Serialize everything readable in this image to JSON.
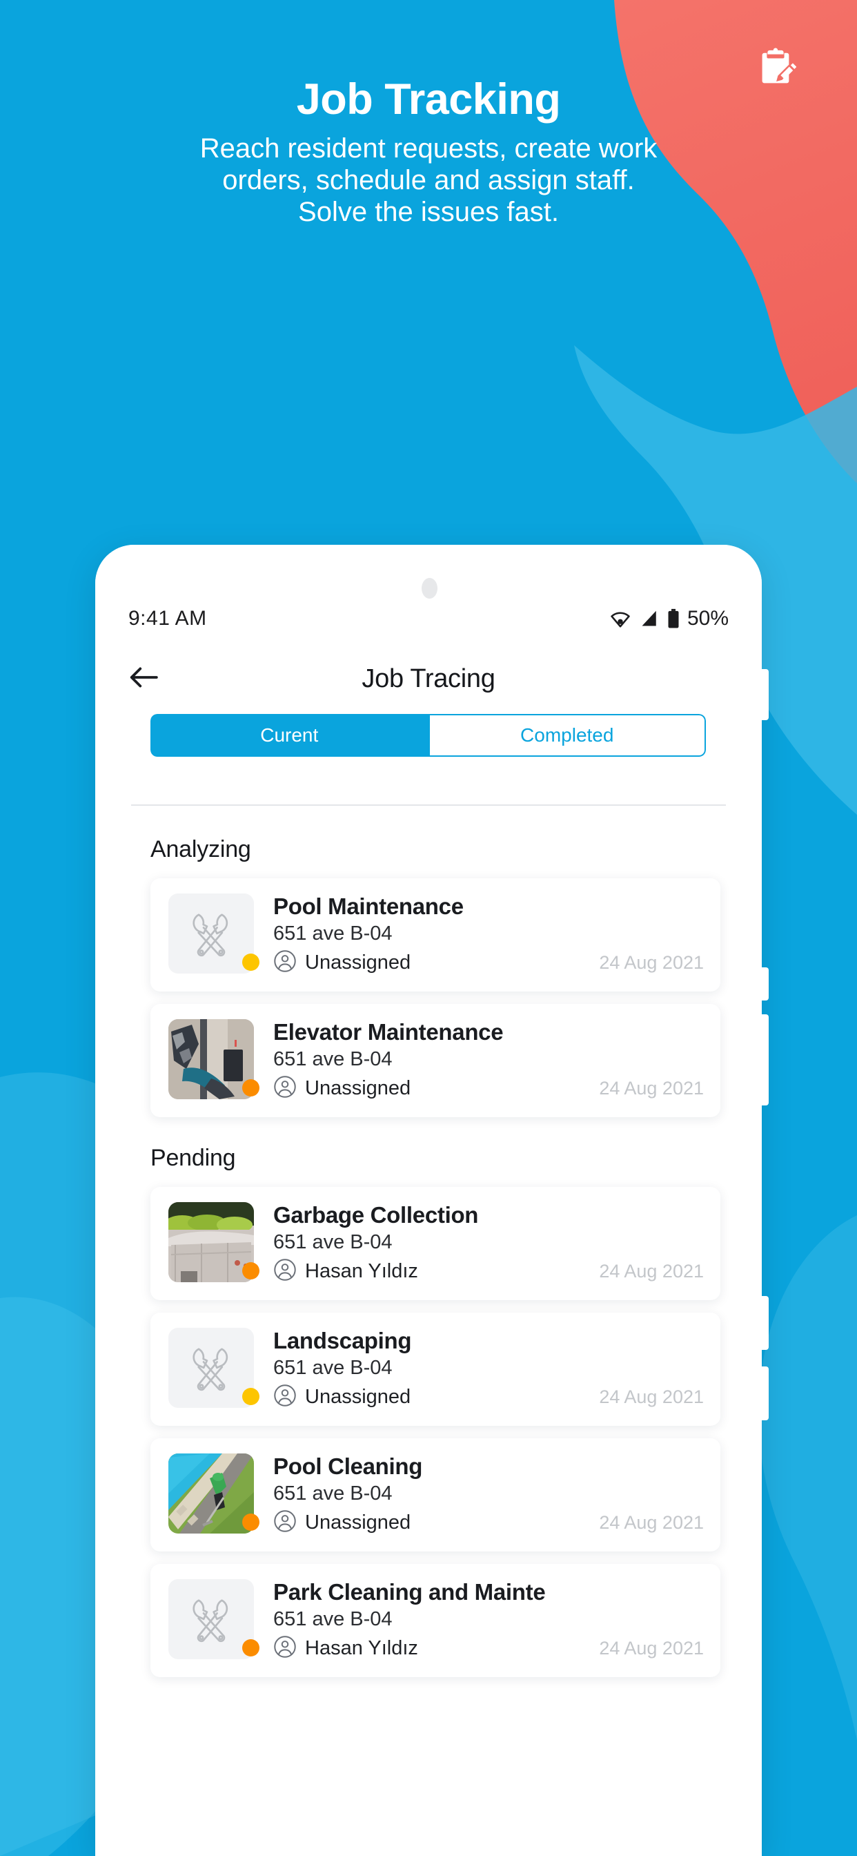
{
  "promo": {
    "title": "Job Tracking",
    "subtitle_lines": [
      "Reach resident requests, create work",
      "orders, schedule and assign staff.",
      "Solve the issues fast."
    ],
    "icon": "clipboard-pencil-icon"
  },
  "colors": {
    "brand_blue": "#0aa4dd",
    "brand_blue_light": "#35b8e6",
    "coral": "#f4695f",
    "status_yellow": "#fdc500",
    "status_orange": "#fb8c00",
    "text_dark": "#16181c",
    "text_muted": "#c3c6ca"
  },
  "phone": {
    "statusbar": {
      "time": "9:41  AM",
      "battery_percent": "50%",
      "icons": [
        "wifi-icon",
        "cellular-signal-icon",
        "battery-icon"
      ]
    },
    "header": {
      "back_icon": "arrow-left-icon",
      "title": "Job Tracing"
    },
    "tabs": [
      {
        "label": "Curent",
        "active": true
      },
      {
        "label": "Completed",
        "active": false
      }
    ],
    "sections": [
      {
        "title": "Analyzing",
        "jobs": [
          {
            "title": "Pool Maintenance",
            "address": "651 ave B-04",
            "assignee": "Unassigned",
            "date": "24 Aug 2021",
            "status_color": "#fdc500",
            "thumb": "tools-icon"
          },
          {
            "title": "Elevator Maintenance",
            "address": "651 ave B-04",
            "assignee": "Unassigned",
            "date": "24 Aug 2021",
            "status_color": "#fb8c00",
            "thumb": "elevator-photo"
          }
        ]
      },
      {
        "title": "Pending",
        "jobs": [
          {
            "title": "Garbage Collection",
            "address": "651 ave B-04",
            "assignee": "Hasan Yıldız",
            "date": "24 Aug 2021",
            "status_color": "#fb8c00",
            "thumb": "garbage-photo"
          },
          {
            "title": "Landscaping",
            "address": "651 ave B-04",
            "assignee": "Unassigned",
            "date": "24 Aug 2021",
            "status_color": "#fdc500",
            "thumb": "tools-icon"
          },
          {
            "title": "Pool Cleaning",
            "address": "651 ave B-04",
            "assignee": "Unassigned",
            "date": "24 Aug 2021",
            "status_color": "#fb8c00",
            "thumb": "pool-photo"
          },
          {
            "title": "Park Cleaning and Mainte",
            "address": "651 ave B-04",
            "assignee": "Hasan Yıldız",
            "date": "24 Aug 2021",
            "status_color": "#fb8c00",
            "thumb": "tools-icon"
          }
        ]
      }
    ]
  }
}
